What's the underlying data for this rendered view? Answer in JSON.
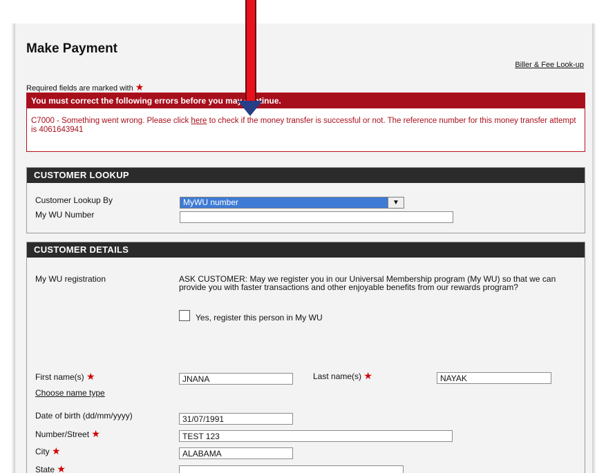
{
  "header": {
    "title": "Make Payment",
    "biller_link": "Biller & Fee Look-up",
    "required_note": "Required fields are marked with"
  },
  "error": {
    "heading": "You must correct the following errors before you may continue.",
    "message_before_link": "C7000 - Something went wrong. Please click ",
    "link_text": "here",
    "message_after_link": " to check if the money transfer is successful or not. The reference number for this money transfer attempt is 4061643941"
  },
  "customer_lookup": {
    "title": "CUSTOMER LOOKUP",
    "lookup_by_label": "Customer Lookup By",
    "lookup_by_value": "MyWU number",
    "wu_number_label": "My WU Number",
    "wu_number_value": ""
  },
  "customer_details": {
    "title": "CUSTOMER DETAILS",
    "registration_label": "My WU registration",
    "ask_text": "ASK CUSTOMER: May we register you in our Universal Membership program (My WU) so that we can provide you with faster transactions and other enjoyable benefits from our rewards program?",
    "register_checkbox_label": "Yes, register this person in My WU",
    "first_name_label": "First name(s)",
    "first_name_value": "JNANA",
    "last_name_label": "Last name(s)",
    "last_name_value": "NAYAK",
    "choose_name_type": "Choose name type",
    "dob_label": "Date of birth (dd/mm/yyyy)",
    "dob_value": "31/07/1991",
    "street_label": "Number/Street",
    "street_value": "TEST 123",
    "city_label": "City",
    "city_value": "ALABAMA",
    "state_label": "State"
  },
  "colors": {
    "error_red": "#a80f1c",
    "section_header": "#2b2b2b",
    "select_highlight": "#3d7bd6",
    "annotation_arrow": "#e8121c"
  }
}
